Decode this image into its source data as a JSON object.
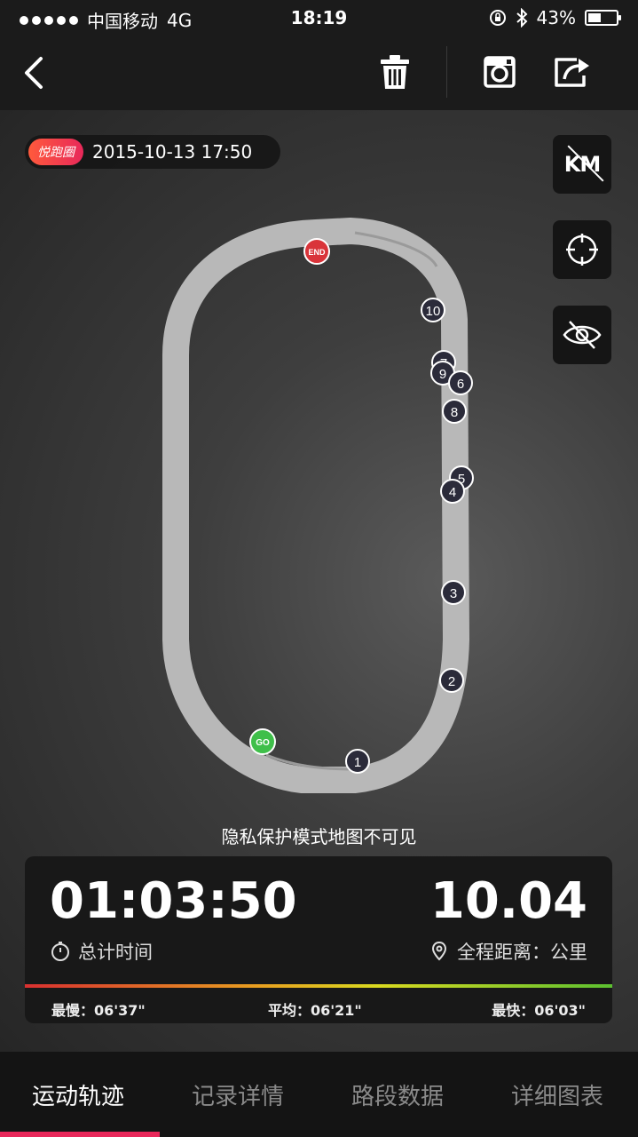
{
  "status_bar": {
    "carrier": "中国移动",
    "network": "4G",
    "time": "18:19",
    "battery": "43%"
  },
  "toolbar": {
    "back_icon": "chevron-left-icon",
    "delete_icon": "trash-icon",
    "instagram_icon": "instagram-icon",
    "share_icon": "share-icon"
  },
  "record": {
    "brand": "悦跑圈",
    "datetime": "2015-10-13 17:50"
  },
  "map_controls": {
    "km_label": "KM",
    "locate_icon": "crosshair-icon",
    "privacy_icon": "eye-off-icon"
  },
  "track": {
    "start_label": "GO",
    "end_label": "END",
    "markers": [
      "1",
      "2",
      "3",
      "4",
      "5",
      "6",
      "7",
      "8",
      "9",
      "10"
    ]
  },
  "privacy_notice": "隐私保护模式地图不可见",
  "stats": {
    "total_time": "01:03:50",
    "total_time_label": "总计时间",
    "distance": "10.04",
    "distance_label": "全程距离：公里",
    "slowest": "最慢：06'37\"",
    "average": "平均：06'21\"",
    "fastest": "最快：06'03\""
  },
  "tabs": [
    {
      "label": "运动轨迹"
    },
    {
      "label": "记录详情"
    },
    {
      "label": "路段数据"
    },
    {
      "label": "详细图表"
    }
  ],
  "colors": {
    "accent": "#e8285a",
    "go": "#3fbf4a",
    "end": "#d9343a"
  }
}
